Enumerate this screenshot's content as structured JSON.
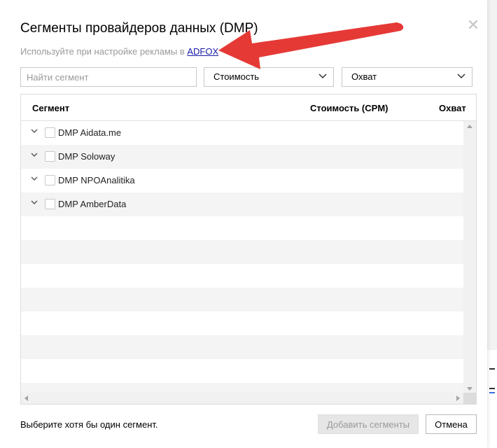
{
  "modal": {
    "title": "Сегменты провайдеров данных (DMP)",
    "close_glyph": "✕",
    "subtitle_prefix": "Используйте при настройке рекламы в",
    "subtitle_link": "ADFOX"
  },
  "filters": {
    "search_placeholder": "Найти сегмент",
    "cost_select": "Стоимость",
    "reach_select": "Охват"
  },
  "table": {
    "columns": {
      "segment": "Сегмент",
      "cost": "Стоимость (CPM)",
      "reach": "Охват"
    },
    "rows": [
      {
        "label": "DMP Aidata.me"
      },
      {
        "label": "DMP Soloway"
      },
      {
        "label": "DMP NPOAnalitika"
      },
      {
        "label": "DMP AmberData"
      }
    ]
  },
  "footer": {
    "message": "Выберите хотя бы один сегмент.",
    "add_button": "Добавить сегменты",
    "cancel_button": "Отмена"
  },
  "colors": {
    "link": "#1a1aa6",
    "annotation_arrow": "#e53935",
    "disabled_button_bg": "#e6e6e6",
    "alt_row_bg": "#f4f4f4"
  }
}
